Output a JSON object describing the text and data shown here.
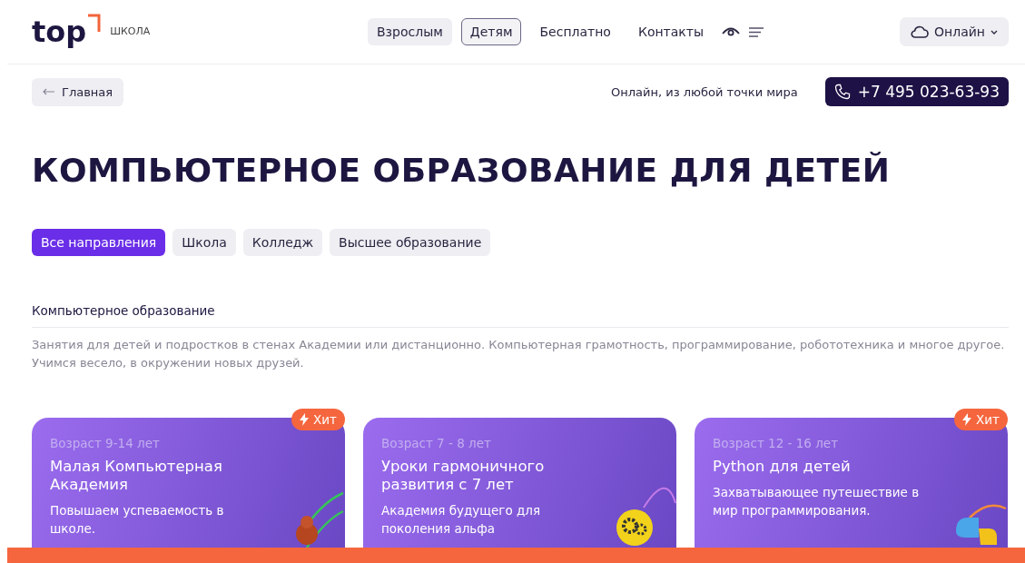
{
  "logo": {
    "wordmark": "top",
    "subtitle": "ШКОЛА"
  },
  "nav": [
    {
      "label": "Взрослым",
      "selected": false
    },
    {
      "label": "Детям",
      "selected": true
    },
    {
      "label": "Бесплатно",
      "selected": false
    },
    {
      "label": "Контакты",
      "selected": false
    }
  ],
  "region_button": {
    "label": "Онлайн"
  },
  "back_link": {
    "label": "Главная"
  },
  "tagline": "Онлайн, из любой точки мира",
  "phone": "+7 495 023-63-93",
  "heading": "КОМПЬЮТЕРНОЕ ОБРАЗОВАНИЕ ДЛЯ ДЕТЕЙ",
  "filters": [
    {
      "label": "Все направления",
      "selected": true
    },
    {
      "label": "Школа",
      "selected": false
    },
    {
      "label": "Колледж",
      "selected": false
    },
    {
      "label": "Высшее образование",
      "selected": false
    }
  ],
  "section": {
    "title": "Компьютерное образование",
    "description": "Занятия для детей и подростков в стенах Академии или дистанционно. Компьютерная грамотность, программирование, робототехника и многое другое. Учимся весело, в окружении новых друзей."
  },
  "cards": [
    {
      "age": "Возраст 9-14 лет",
      "title": "Малая Компьютерная Академия",
      "text": "Повышаем успеваемость в школе.",
      "hit": true,
      "badge": "Хит",
      "kind": "robot"
    },
    {
      "age": "Возраст 7 - 8 лет",
      "title": "Уроки гармоничного развития с 7 лет",
      "text": "Академия будущего для поколения альфа",
      "hit": false,
      "kind": "gears"
    },
    {
      "age": "Возраст 12 - 16 лет",
      "title": "Python для детей",
      "text": "Захватывающее путешествие в мир программирования.",
      "hit": true,
      "badge": "Хит",
      "kind": "python"
    }
  ]
}
